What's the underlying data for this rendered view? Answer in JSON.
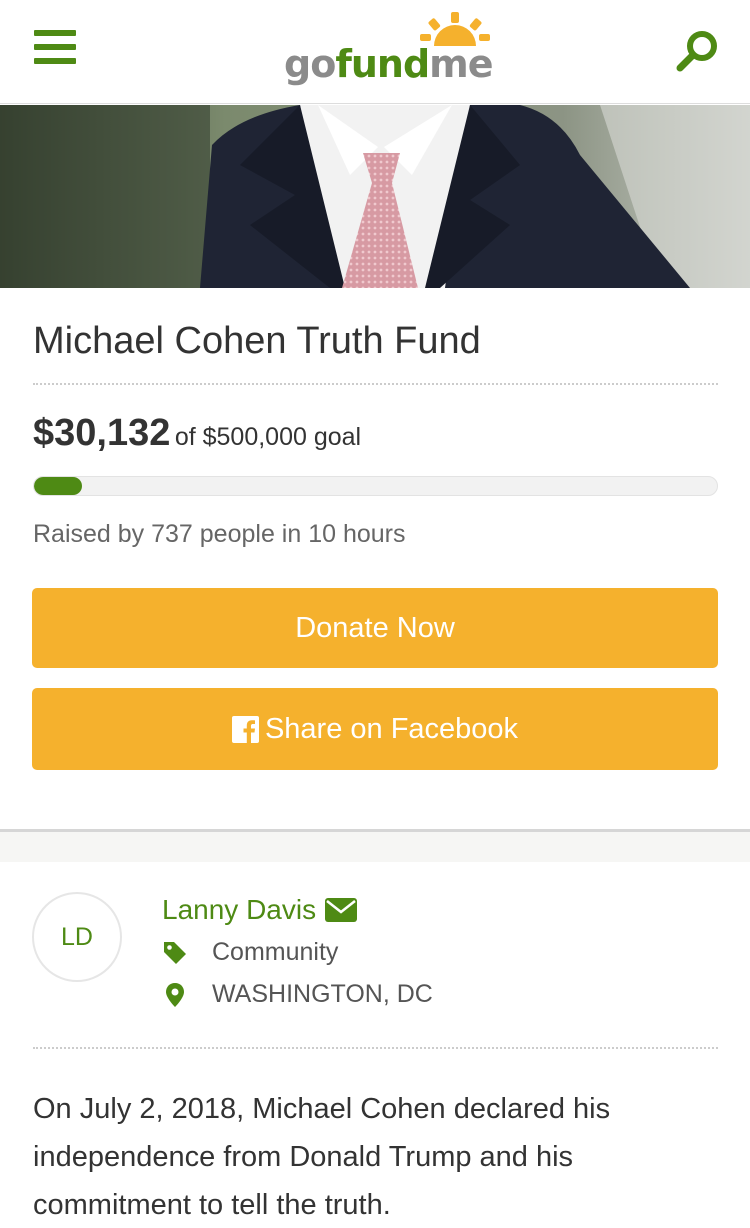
{
  "header": {
    "menu_icon": "hamburger-icon",
    "logo": {
      "go": "go",
      "fund": "fund",
      "me": "me"
    },
    "search_icon": "search-icon"
  },
  "campaign": {
    "title": "Michael Cohen Truth Fund",
    "raised_amount": "$30,132",
    "goal_text": "of $500,000 goal",
    "progress_fraction": 0.0603,
    "raised_by": "Raised by 737 people in 10 hours"
  },
  "actions": {
    "donate_label": "Donate Now",
    "share_label": "Share on Facebook",
    "share_icon": "facebook-icon"
  },
  "organizer": {
    "initials": "LD",
    "name": "Lanny Davis",
    "contact_icon": "envelope-icon",
    "category_icon": "tag-icon",
    "category": "Community",
    "location_icon": "map-pin-icon",
    "location": "WASHINGTON, DC"
  },
  "description": "On July 2, 2018, Michael Cohen declared his independence from Donald Trump and his commitment to tell the truth.",
  "colors": {
    "brand_green": "#4e8a14",
    "button_yellow": "#f5b12d",
    "text": "#333333"
  }
}
